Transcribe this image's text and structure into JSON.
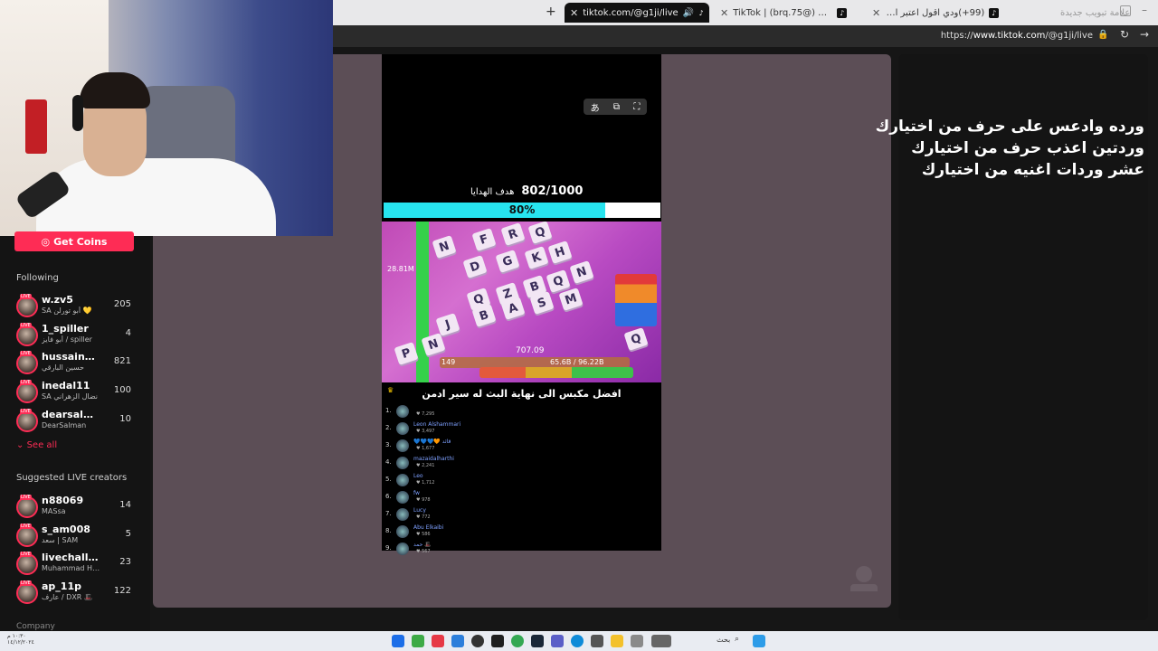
{
  "browser": {
    "tabs": [
      {
        "title": "tiktok.com/@g1ji/live",
        "active": true
      },
      {
        "title": "TikTok | (brq.75@) برق🐺",
        "active": false
      },
      {
        "title": "(99+)ودي اقول اعتبر الكل عمك بس",
        "active": false
      },
      {
        "title": "علامة تبويب جديدة",
        "active": false
      }
    ],
    "new_tab_icon": "plus-icon",
    "url_prefix": "https://",
    "url_domain": "www.tiktok.com",
    "url_path": "/@g1ji/live"
  },
  "sidebar": {
    "get_coins_label": "Get Coins",
    "following_heading": "Following",
    "following": [
      {
        "name": "w.zv5",
        "sub": "SA أبو تورلن 💛",
        "count": "205"
      },
      {
        "name": "1_spiller",
        "sub": "أبو فايز / spiller",
        "count": "4"
      },
      {
        "name": "hussainas...",
        "sub": "حسين البارقي",
        "count": "821"
      },
      {
        "name": "inedal11",
        "sub": "SA نضال الزهراني",
        "count": "100"
      },
      {
        "name": "dearsalman_",
        "sub": "DearSalman",
        "count": "10"
      }
    ],
    "see_all_label": "See all",
    "suggested_heading": "Suggested LIVE creators",
    "suggested": [
      {
        "name": "n88069",
        "sub": "MASsa",
        "count": "14"
      },
      {
        "name": "s_am008",
        "sub": "سعد | SAM",
        "count": "5"
      },
      {
        "name": "livechallen...",
        "sub": "Muhammad Has...",
        "count": "23"
      },
      {
        "name": "ap_11p",
        "sub": "عارف / DXR 🎩",
        "count": "122"
      }
    ],
    "company_label": "Company",
    "live_badge": "LIVE"
  },
  "stream": {
    "overlay_lines": [
      "ورده وادعس على حرف من اختيارك",
      "وردتين اعذب حرف من اختيارك",
      "عشر وردات اغنيه من اختيارك"
    ],
    "goal_value": "802/1000",
    "goal_label": "هدف الهدايا",
    "progress_percent": 80,
    "progress_label": "80%",
    "game_keys": [
      "N",
      "F",
      "R",
      "Q",
      "D",
      "G",
      "K",
      "H",
      "Q",
      "Z",
      "B",
      "Q",
      "N",
      "J",
      "B",
      "A",
      "S",
      "M",
      "P",
      "N",
      "Q"
    ],
    "game_hud": {
      "score": "707.09",
      "bar_text": "65.6B / 96.22B",
      "level": "149",
      "left_stat": "28.81M"
    },
    "chat_title": "افضل مكبس الى نهاية البث له سير ادمن",
    "leaderboard": [
      {
        "rank": "1.",
        "name": "",
        "sub": "7,295"
      },
      {
        "rank": "2.",
        "name": "Leon Alshammari",
        "sub": "3,497"
      },
      {
        "rank": "3.",
        "name": "💙💙💙🧡 قائد",
        "sub": "1,677"
      },
      {
        "rank": "4.",
        "name": "mazaidalharthi",
        "sub": "2,241"
      },
      {
        "rank": "5.",
        "name": "Leo",
        "sub": "1,712"
      },
      {
        "rank": "6.",
        "name": "fw",
        "sub": "978"
      },
      {
        "rank": "7.",
        "name": "Lucy",
        "sub": "772"
      },
      {
        "rank": "8.",
        "name": "Abu Elkaibi",
        "sub": "586"
      },
      {
        "rank": "9.",
        "name": "حمد 🎩",
        "sub": "567"
      }
    ]
  },
  "taskbar": {
    "search_text": "بحث",
    "clock_time": "١٠:٣٠ م",
    "clock_date": "١٤/١٢/٢٠٢٤"
  },
  "colors": {
    "accent": "#fe2c55",
    "progress": "#27e4ef",
    "content_bg": "#5c4e56"
  }
}
